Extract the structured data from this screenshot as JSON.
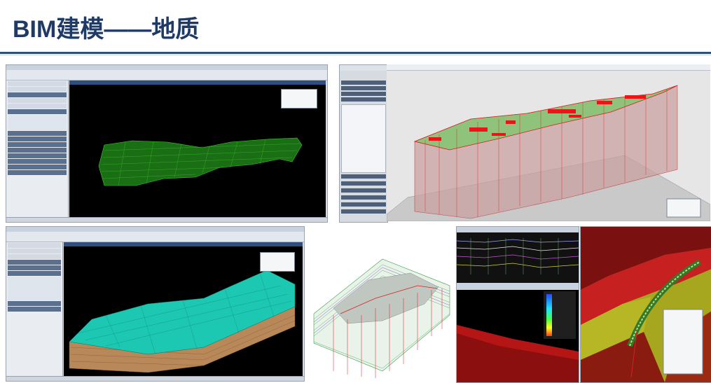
{
  "slide": {
    "title": "BIM建模——地质"
  },
  "colors": {
    "title": "#1f3a66",
    "rule": "#2d4f7a",
    "terrain_green": "#1f9a20",
    "mesh_cyan": "#19c6b0",
    "strata_tan": "#b8875a",
    "bore_red": "#e01818"
  },
  "screenshots": {
    "topleft": {
      "icon": "terrain-mesh-view"
    },
    "topright": {
      "icon": "geology-block-view"
    },
    "bottomleft": {
      "icon": "strata-terrain-view"
    },
    "bottommid": {
      "icon": "boreholes-view"
    },
    "bottomright1": {
      "icon": "section-contour-view"
    },
    "bottomright2": {
      "icon": "tunnel-geology-view"
    }
  }
}
